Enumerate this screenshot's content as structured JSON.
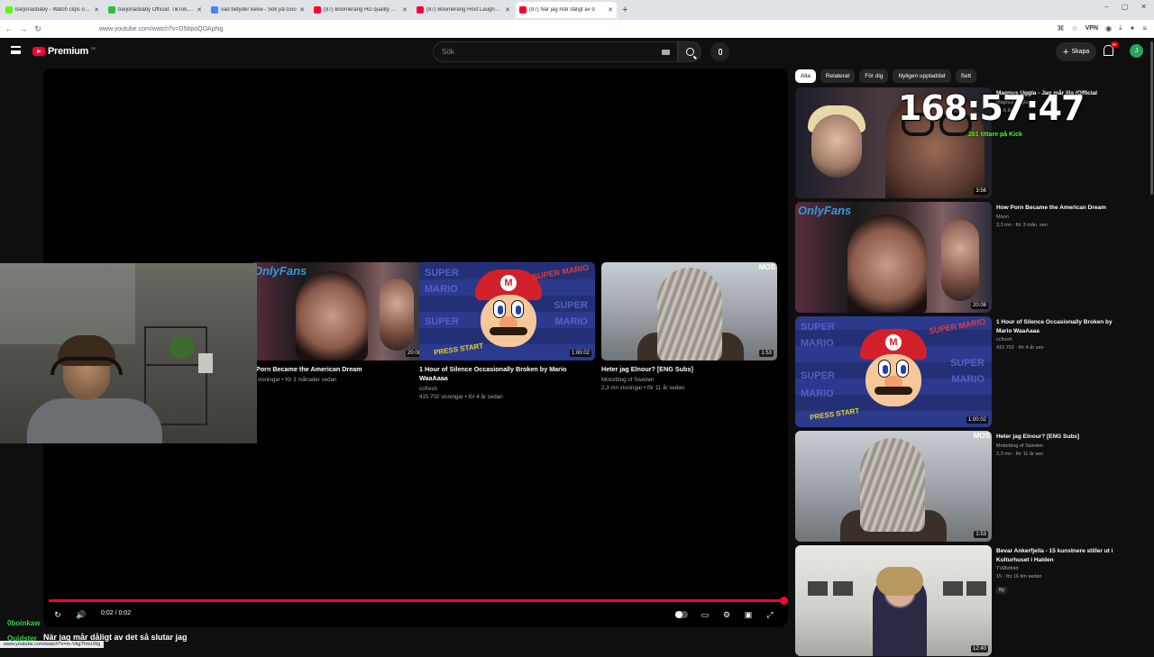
{
  "browser": {
    "tabs": [
      {
        "title": "barjonasbaby - Watch clips on K",
        "color": "#53fc18"
      },
      {
        "title": "barjonasbaby Official: TikTok, In",
        "color": "#2fc03a"
      },
      {
        "title": "vad betyder kekw - Sök på Goo",
        "color": "#4285f4"
      },
      {
        "title": "(87) Boomerang HD quality with",
        "color": "#ff0033"
      },
      {
        "title": "(87) Boomerang Host Laughs at",
        "color": "#ff0033"
      },
      {
        "title": "(87) När jag mår dåligt av d",
        "color": "#ff0033"
      }
    ],
    "url": "www.youtube.com/watch?v=D5bpoQOApNg",
    "vpn_label": "VPN"
  },
  "youtube": {
    "logo": "Premium",
    "logo_sup": "SE",
    "search_placeholder": "Sök",
    "create_label": "Skapa",
    "notif_count": "9+",
    "avatar_letter": "J"
  },
  "end_screen": [
    {
      "title": "Porn Became the American Dream",
      "meta1": "visningar • för 3 månader sedan",
      "meta2": "",
      "duration": "20:08",
      "thumb": "porn"
    },
    {
      "title": "1 Hour of Silence Occasionally Broken by Mario WaaAaaa",
      "meta1": "ccfresh",
      "meta2": "415 702 visningar • för 4 år sedan",
      "duration": "1:00:02",
      "thumb": "mario"
    },
    {
      "title": "Heter jag Elnour? [ENG Subs]",
      "meta1": "Motorblog of Sweden",
      "meta2": "2,3 mn visningar • för 11 år sedan",
      "duration": "1:53",
      "thumb": "snow"
    }
  ],
  "player": {
    "time": "0:02 / 0:02",
    "progress": 1.0
  },
  "chips": [
    "Alla",
    "Relaterat",
    "För dig",
    "Nyligen uppladdat",
    "Sett"
  ],
  "recommendations": [
    {
      "title": "Magnus Uggla - Jag mår illa (Official",
      "channel": "Magnus Uggla",
      "meta": "för 6 år",
      "duration": "3:56",
      "thumb": "glasses",
      "new": false
    },
    {
      "title": "How Porn Became the American Dream",
      "channel": "Moon",
      "meta": "2,3 mn · för 3 mån. sen",
      "duration": "20:08",
      "thumb": "porn",
      "new": false
    },
    {
      "title": "1 Hour of Silence Occasionally Broken by Mario WaaAaaa",
      "channel": "ccfresh",
      "meta": "415 702 · för 4 år sen",
      "duration": "1:00:02",
      "thumb": "mario",
      "new": false
    },
    {
      "title": "Heter jag Elnour? [ENG Subs]",
      "channel": "Motorblog of Sweden",
      "meta": "2,3 mn · för 11 år sen",
      "duration": "1:53",
      "thumb": "snow",
      "new": false
    },
    {
      "title": "Bevar Ankerfjella - 15 kunstnere stiller ut i Kulturhuset i Halden",
      "channel": "TVØstfold",
      "meta": "15 · för 16 tim sedan",
      "duration": "12:40",
      "thumb": "interior",
      "new": true,
      "new_label": "Ny"
    }
  ],
  "stream_overlay": {
    "timer": "168:57:47",
    "viewers": "261 tittare på Kick",
    "chat": [
      {
        "user": "0boinkaw",
        "msg": ""
      },
      {
        "user": "Quidster",
        "msg": ""
      }
    ],
    "title": "När jag mår dåligt av det så slutar jag",
    "status_url": "www.youtube.com/watch?v=m-VkgThmLWg"
  }
}
